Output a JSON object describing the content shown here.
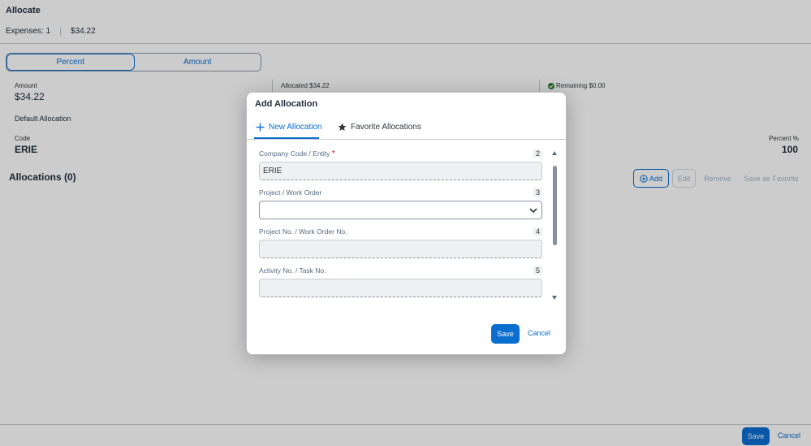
{
  "page": {
    "title": "Allocate",
    "expenses_label": "Expenses: 1",
    "expenses_total": "$34.22",
    "segment": {
      "percent": "Percent",
      "amount": "Amount"
    },
    "amount_label": "Amount",
    "amount_value": "$34.22",
    "allocated": "Allocated $34.22",
    "remaining": "Remaining $0.00",
    "default_allocation": "Default Allocation",
    "code_label": "Code",
    "code_value": "ERIE",
    "percent_label": "Percent %",
    "percent_value": "100",
    "allocations_title": "Allocations (0)",
    "toolbar": {
      "add": "Add",
      "edit": "Edit",
      "remove": "Remove",
      "save_favorite": "Save as Favorite"
    },
    "footer": {
      "save": "Save",
      "cancel": "Cancel"
    }
  },
  "dialog": {
    "title": "Add Allocation",
    "tabs": {
      "new": "New Allocation",
      "favorites": "Favorite Allocations"
    },
    "fields": [
      {
        "label": "Company Code / Entity",
        "required": "*",
        "number": "2",
        "value": "ERIE"
      },
      {
        "label": "Project / Work Order",
        "number": "3",
        "value": ""
      },
      {
        "label": "Project No. / Work Order No.",
        "number": "4",
        "value": ""
      },
      {
        "label": "Activity No. / Task No.",
        "number": "5",
        "value": ""
      }
    ],
    "save": "Save",
    "cancel": "Cancel"
  },
  "colors": {
    "accent": "#0a6ed1",
    "success": "#2b7c2b",
    "required": "#d0021b"
  },
  "icons": [
    "plus-icon",
    "star-icon",
    "check-circle-icon",
    "add-circle-icon",
    "chevron-down-icon"
  ]
}
